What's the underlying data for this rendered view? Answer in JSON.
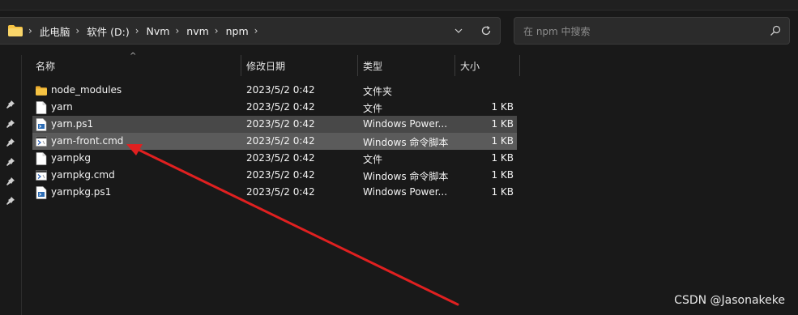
{
  "breadcrumb": {
    "items": [
      "此电脑",
      "软件 (D:)",
      "Nvm",
      "nvm",
      "npm"
    ]
  },
  "search": {
    "placeholder": "在 npm 中搜索"
  },
  "columns": {
    "name": "名称",
    "date": "修改日期",
    "type": "类型",
    "size": "大小"
  },
  "files": [
    {
      "name": "node_modules",
      "date": "2023/5/2 0:42",
      "type": "文件夹",
      "size": "",
      "icon": "folder-icon"
    },
    {
      "name": "yarn",
      "date": "2023/5/2 0:42",
      "type": "文件",
      "size": "1 KB",
      "icon": "file-icon"
    },
    {
      "name": "yarn.ps1",
      "date": "2023/5/2 0:42",
      "type": "Windows Power...",
      "size": "1 KB",
      "icon": "powershell-script-icon"
    },
    {
      "name": "yarn-front.cmd",
      "date": "2023/5/2 0:42",
      "type": "Windows 命令脚本",
      "size": "1 KB",
      "icon": "cmd-script-icon"
    },
    {
      "name": "yarnpkg",
      "date": "2023/5/2 0:42",
      "type": "文件",
      "size": "1 KB",
      "icon": "file-icon"
    },
    {
      "name": "yarnpkg.cmd",
      "date": "2023/5/2 0:42",
      "type": "Windows 命令脚本",
      "size": "1 KB",
      "icon": "cmd-script-icon"
    },
    {
      "name": "yarnpkg.ps1",
      "date": "2023/5/2 0:42",
      "type": "Windows Power...",
      "size": "1 KB",
      "icon": "powershell-script-icon"
    }
  ],
  "watermark": "CSDN @Jasonakeke",
  "colors": {
    "background": "#191919",
    "selected_row": "#484848",
    "hover_row": "#5b5b5b",
    "annotation_arrow": "#e02020",
    "folder": "#f6c343"
  }
}
